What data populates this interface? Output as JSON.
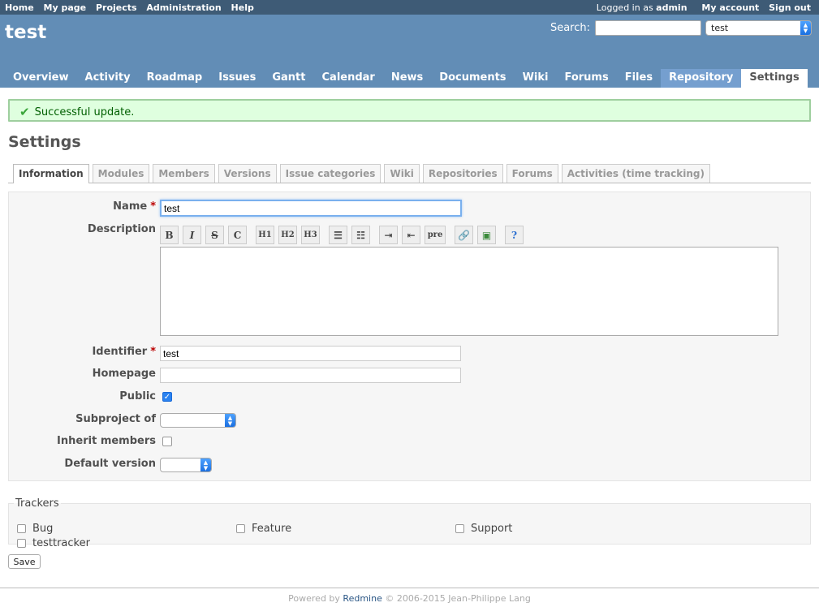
{
  "top_menu": {
    "items": [
      "Home",
      "My page",
      "Projects",
      "Administration",
      "Help"
    ],
    "logged_in_prefix": "Logged in as",
    "user": "admin",
    "my_account": "My account",
    "sign_out": "Sign out"
  },
  "header": {
    "title": "test",
    "search_label": "Search:",
    "search_value": "",
    "project_select": "test"
  },
  "main_menu": [
    "Overview",
    "Activity",
    "Roadmap",
    "Issues",
    "Gantt",
    "Calendar",
    "News",
    "Documents",
    "Wiki",
    "Forums",
    "Files",
    "Repository",
    "Settings"
  ],
  "flash": "Successful update.",
  "page_title": "Settings",
  "tabs": [
    "Information",
    "Modules",
    "Members",
    "Versions",
    "Issue categories",
    "Wiki",
    "Repositories",
    "Forums",
    "Activities (time tracking)"
  ],
  "form": {
    "name_label": "Name",
    "name_value": "test",
    "description_label": "Description",
    "identifier_label": "Identifier",
    "identifier_value": "test",
    "homepage_label": "Homepage",
    "public_label": "Public",
    "public_checked": true,
    "subproject_label": "Subproject of",
    "inherit_label": "Inherit members",
    "default_version_label": "Default version",
    "required_mark": "*"
  },
  "toolbar": [
    "B",
    "I",
    "S",
    "C",
    "H1",
    "H2",
    "H3",
    "ul",
    "ol",
    "indent",
    "outdent",
    "pre",
    "link",
    "image",
    "help"
  ],
  "trackers": {
    "legend": "Trackers",
    "items": [
      "Bug",
      "Feature",
      "Support",
      "testtracker"
    ]
  },
  "save_label": "Save",
  "footer": {
    "prefix": "Powered by",
    "link": "Redmine",
    "suffix": "© 2006-2015 Jean-Philippe Lang"
  }
}
